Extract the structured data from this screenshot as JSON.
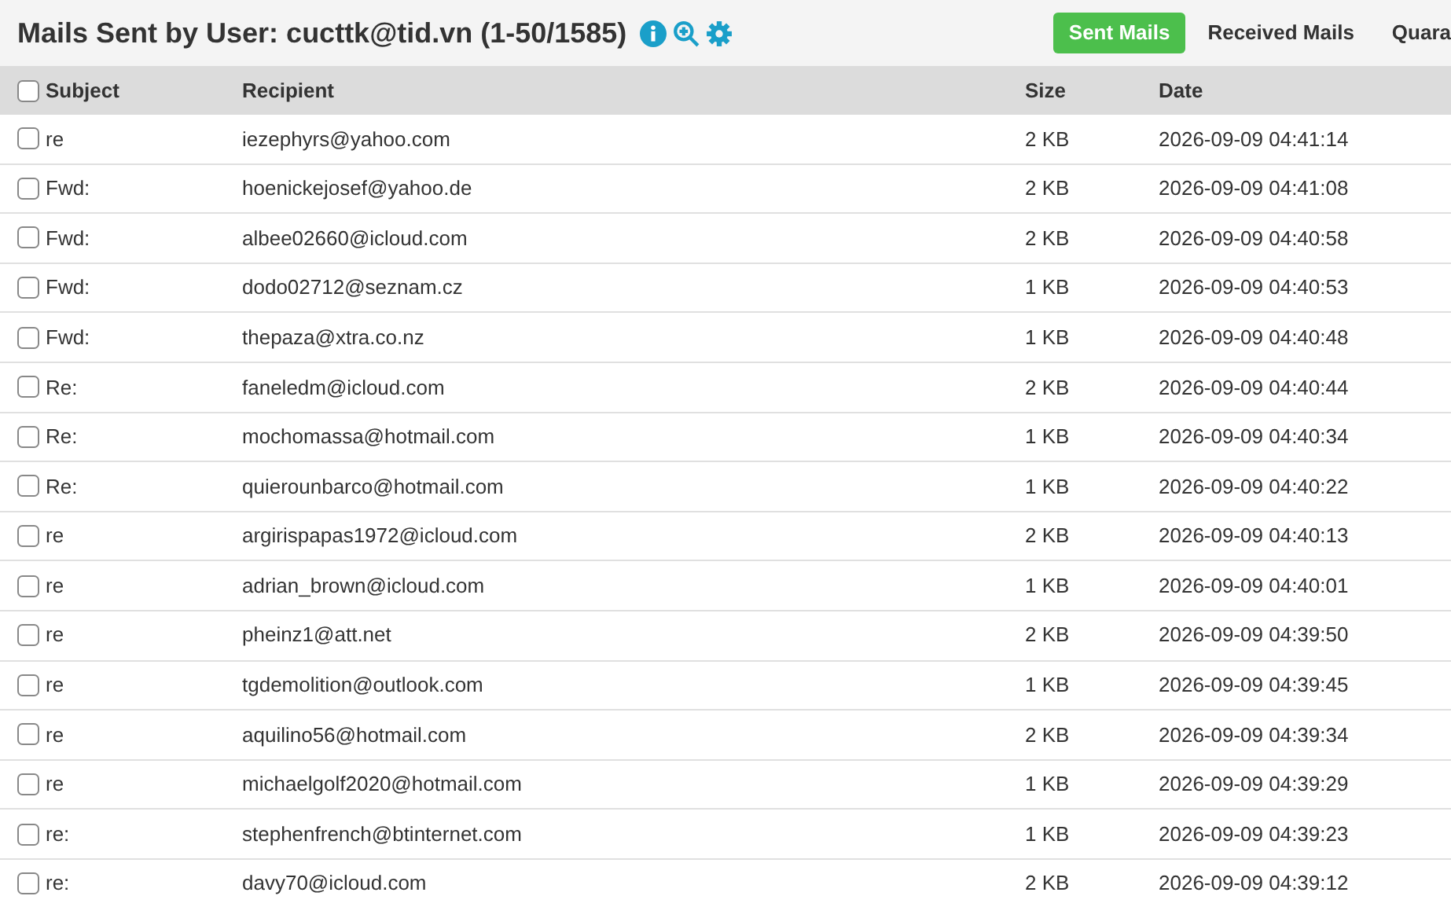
{
  "header": {
    "title": "Mails Sent by User: cucttk@tid.vn (1-50/1585)"
  },
  "tabs": [
    {
      "label": "Sent Mails",
      "selected": true
    },
    {
      "label": "Received Mails",
      "selected": false
    },
    {
      "label": "Quara",
      "selected": false
    }
  ],
  "table": {
    "select_all_checked": false,
    "columns": [
      "Subject",
      "Recipient",
      "Size",
      "Date"
    ],
    "rows": [
      {
        "checked": false,
        "cells": [
          "re",
          "iezephyrs@yahoo.com",
          "2 KB",
          "2026-09-09 04:41:14"
        ]
      },
      {
        "checked": false,
        "cells": [
          "Fwd:",
          "hoenickejosef@yahoo.de",
          "2 KB",
          "2026-09-09 04:41:08"
        ]
      },
      {
        "checked": false,
        "cells": [
          "Fwd:",
          "albee02660@icloud.com",
          "2 KB",
          "2026-09-09 04:40:58"
        ]
      },
      {
        "checked": false,
        "cells": [
          "Fwd:",
          "dodo02712@seznam.cz",
          "1 KB",
          "2026-09-09 04:40:53"
        ]
      },
      {
        "checked": false,
        "cells": [
          "Fwd:",
          "thepaza@xtra.co.nz",
          "1 KB",
          "2026-09-09 04:40:48"
        ]
      },
      {
        "checked": false,
        "cells": [
          "Re:",
          "faneledm@icloud.com",
          "2 KB",
          "2026-09-09 04:40:44"
        ]
      },
      {
        "checked": false,
        "cells": [
          "Re:",
          "mochomassa@hotmail.com",
          "1 KB",
          "2026-09-09 04:40:34"
        ]
      },
      {
        "checked": false,
        "cells": [
          "Re:",
          "quierounbarco@hotmail.com",
          "1 KB",
          "2026-09-09 04:40:22"
        ]
      },
      {
        "checked": false,
        "cells": [
          "re",
          "argirispapas1972@icloud.com",
          "2 KB",
          "2026-09-09 04:40:13"
        ]
      },
      {
        "checked": false,
        "cells": [
          "re",
          "adrian_brown@icloud.com",
          "1 KB",
          "2026-09-09 04:40:01"
        ]
      },
      {
        "checked": false,
        "cells": [
          "re",
          "pheinz1@att.net",
          "2 KB",
          "2026-09-09 04:39:50"
        ]
      },
      {
        "checked": false,
        "cells": [
          "re",
          "tgdemolition@outlook.com",
          "1 KB",
          "2026-09-09 04:39:45"
        ]
      },
      {
        "checked": false,
        "cells": [
          "re",
          "aquilino56@hotmail.com",
          "2 KB",
          "2026-09-09 04:39:34"
        ]
      },
      {
        "checked": false,
        "cells": [
          "re",
          "michaelgolf2020@hotmail.com",
          "1 KB",
          "2026-09-09 04:39:29"
        ]
      },
      {
        "checked": false,
        "cells": [
          "re:",
          "stephenfrench@btinternet.com",
          "1 KB",
          "2026-09-09 04:39:23"
        ]
      },
      {
        "checked": false,
        "cells": [
          "re:",
          "davy70@icloud.com",
          "2 KB",
          "2026-09-09 04:39:12"
        ]
      }
    ]
  }
}
